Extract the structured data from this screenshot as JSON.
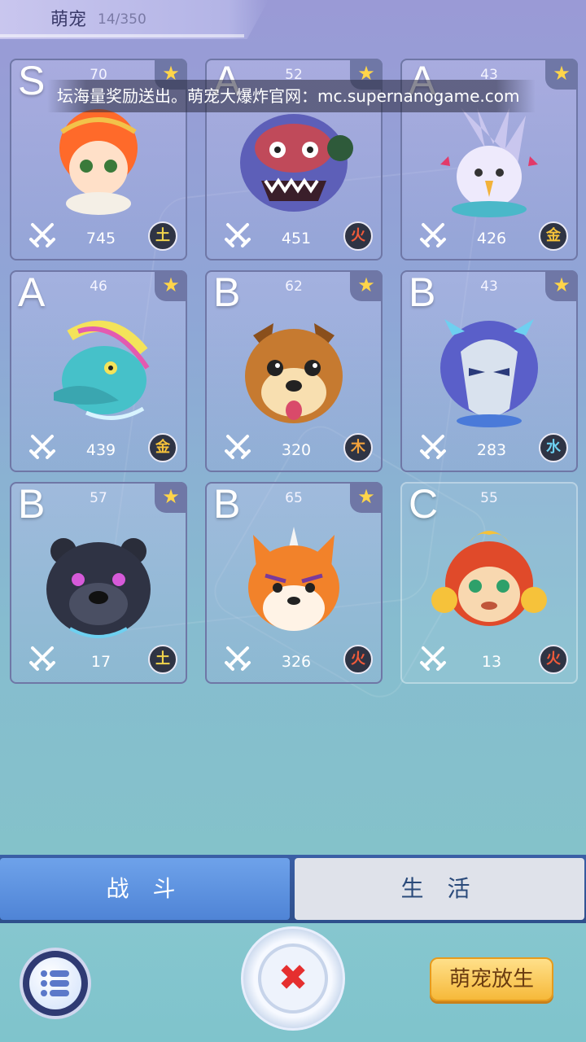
{
  "header": {
    "title": "萌宠",
    "count": "14/350"
  },
  "banner": {
    "text": "坛海量奖励送出。萌宠大爆炸官网：mc.supernanogame.com"
  },
  "pets": [
    {
      "grade": "S",
      "level": "70",
      "power": "745",
      "element": "土",
      "element_color": "#f0d34c",
      "starred": true,
      "creature": "red-haired-boy"
    },
    {
      "grade": "A",
      "level": "52",
      "power": "451",
      "element": "火",
      "element_color": "#f05a3a",
      "starred": true,
      "creature": "blue-masked-monster"
    },
    {
      "grade": "A",
      "level": "43",
      "power": "426",
      "element": "金",
      "element_color": "#f6c23a",
      "starred": true,
      "creature": "white-bird-dragon"
    },
    {
      "grade": "A",
      "level": "46",
      "power": "439",
      "element": "金",
      "element_color": "#f6c23a",
      "starred": true,
      "creature": "teal-dragon"
    },
    {
      "grade": "B",
      "level": "62",
      "power": "320",
      "element": "木",
      "element_color": "#f2a23c",
      "starred": true,
      "creature": "shiba-dog"
    },
    {
      "grade": "B",
      "level": "43",
      "power": "283",
      "element": "水",
      "element_color": "#6ed0f0",
      "starred": true,
      "creature": "armored-knight"
    },
    {
      "grade": "B",
      "level": "57",
      "power": "17",
      "element": "土",
      "element_color": "#f0d34c",
      "starred": true,
      "creature": "black-bear"
    },
    {
      "grade": "B",
      "level": "65",
      "power": "326",
      "element": "火",
      "element_color": "#f05a3a",
      "starred": true,
      "creature": "orange-fox"
    },
    {
      "grade": "C",
      "level": "55",
      "power": "13",
      "element": "火",
      "element_color": "#f05a3a",
      "starred": false,
      "creature": "red-monkey"
    }
  ],
  "tabs": {
    "battle": "战 斗",
    "life": "生 活"
  },
  "buttons": {
    "release": "萌宠放生",
    "close": "✖"
  }
}
